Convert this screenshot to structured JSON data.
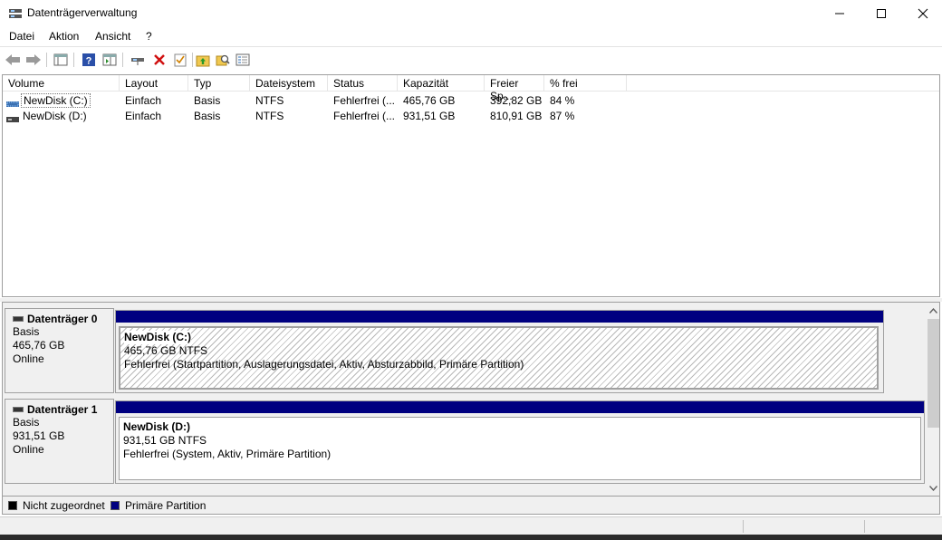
{
  "window": {
    "title": "Datenträgerverwaltung"
  },
  "menu": [
    "Datei",
    "Aktion",
    "Ansicht",
    "?"
  ],
  "toolbar": {
    "icons": [
      "back-arrow-icon",
      "forward-arrow-icon",
      "console-tree-icon",
      "help-icon",
      "action-pane-icon",
      "connect-disk-icon",
      "delete-icon",
      "check-properties-icon",
      "folder-up-icon",
      "search-folder-icon",
      "settings-list-icon"
    ]
  },
  "volumes": {
    "columns": [
      "Volume",
      "Layout",
      "Typ",
      "Dateisystem",
      "Status",
      "Kapazität",
      "Freier Sp...",
      "% frei"
    ],
    "rows": [
      [
        "NewDisk (C:)",
        "Einfach",
        "Basis",
        "NTFS",
        "Fehlerfrei (...",
        "465,76 GB",
        "392,82 GB",
        "84 %"
      ],
      [
        "NewDisk (D:)",
        "Einfach",
        "Basis",
        "NTFS",
        "Fehlerfrei (...",
        "931,51 GB",
        "810,91 GB",
        "87 %"
      ]
    ]
  },
  "disks": [
    {
      "name": "Datenträger 0",
      "type": "Basis",
      "size": "465,76 GB",
      "state": "Online",
      "partition": {
        "title": "NewDisk  (C:)",
        "size_fs": "465,76 GB NTFS",
        "status": "Fehlerfrei (Startpartition, Auslagerungsdatei, Aktiv, Absturzabbild, Primäre Partition)"
      }
    },
    {
      "name": "Datenträger 1",
      "type": "Basis",
      "size": "931,51 GB",
      "state": "Online",
      "partition": {
        "title": "NewDisk  (D:)",
        "size_fs": "931,51 GB NTFS",
        "status": "Fehlerfrei (System, Aktiv, Primäre Partition)"
      }
    }
  ],
  "legend": [
    {
      "label": "Nicht zugeordnet",
      "color": "#000000"
    },
    {
      "label": "Primäre Partition",
      "color": "#000080"
    }
  ],
  "colors": {
    "partition_bar": "#000080",
    "window_bg": "#f0f0f0"
  }
}
